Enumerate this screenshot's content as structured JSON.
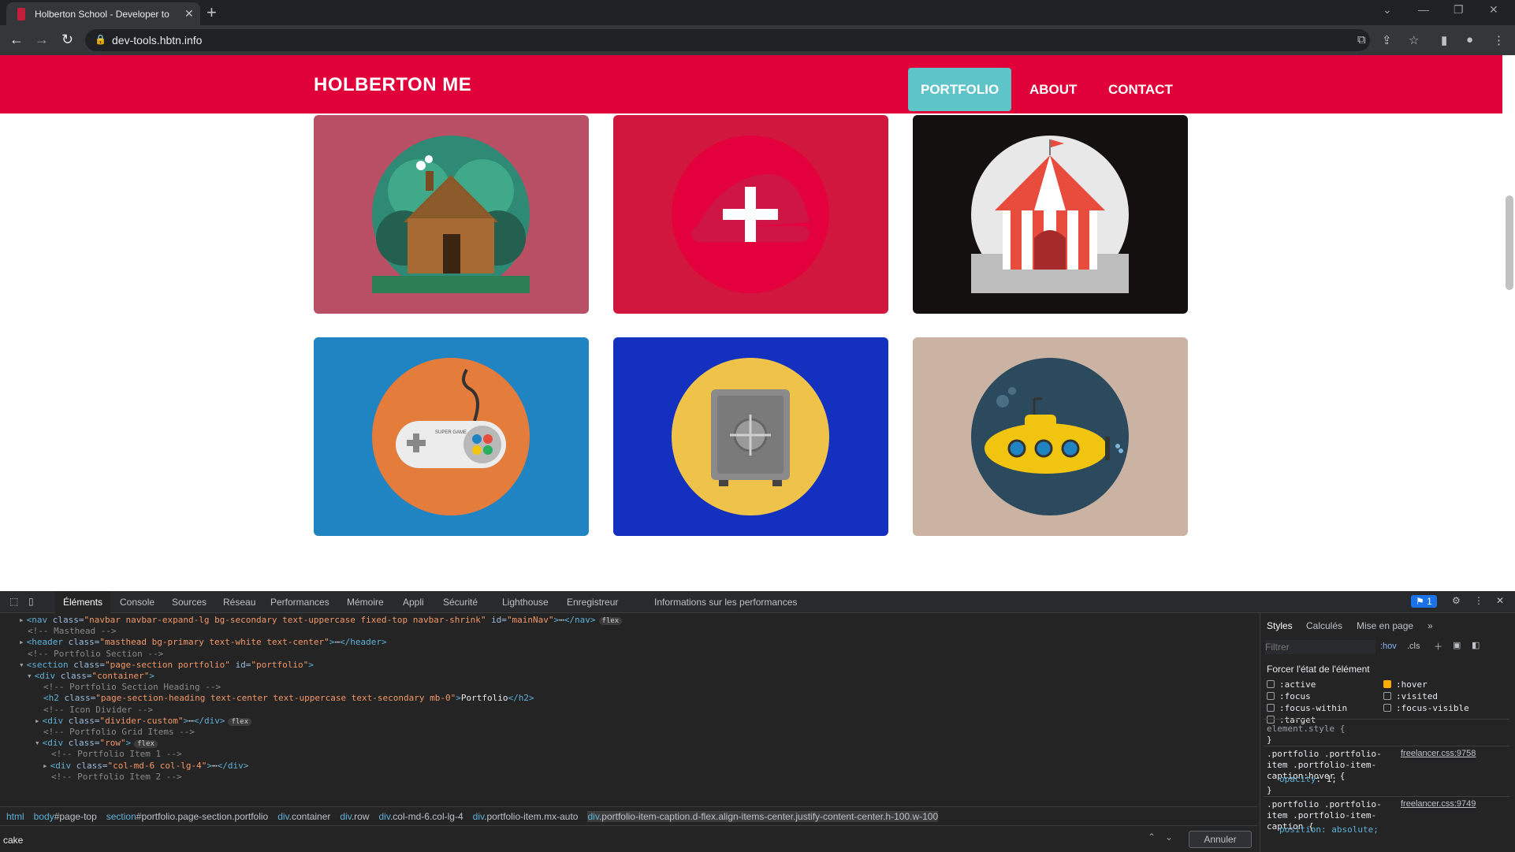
{
  "browser": {
    "tab_title": "Holberton School - Developer to",
    "url": "dev-tools.hbtn.info"
  },
  "site": {
    "brand": "HOLBERTON ME",
    "nav": [
      "PORTFOLIO",
      "ABOUT",
      "CONTACT"
    ],
    "active_nav": "PORTFOLIO",
    "portfolio": [
      {
        "image": "log-cabin",
        "bg": "#b94f65"
      },
      {
        "image": "cake",
        "bg": "#d2173e"
      },
      {
        "image": "circus-tent",
        "bg": "#141010"
      },
      {
        "image": "game-controller",
        "bg": "#1f84c1"
      },
      {
        "image": "safe",
        "bg": "#1430be"
      },
      {
        "image": "submarine",
        "bg": "#cbb3a3"
      }
    ],
    "controller_text": "SUPER GAME"
  },
  "devtools": {
    "tabs": [
      "Éléments",
      "Console",
      "Sources",
      "Réseau",
      "Performances",
      "Mémoire",
      "Appli",
      "Sécurité",
      "Lighthouse",
      "Enregistreur",
      "Informations sur les performances"
    ],
    "issues_count": "1",
    "dom_lines": [
      {
        "indent": 0,
        "arrow": "▸",
        "html": "<span class=\"tag\">&lt;nav</span> <span class=\"att\">class=</span><span class=\"val\">\"navbar navbar-expand-lg bg-secondary text-uppercase fixed-top navbar-shrink\"</span> <span class=\"att\">id=</span><span class=\"val\">\"mainNav\"</span><span class=\"tag\">&gt;</span>⋯<span class=\"tag\">&lt;/nav&gt;</span>",
        "badge": "flex"
      },
      {
        "indent": 0,
        "arrow": "",
        "html": "<span class=\"cm\">&lt;!-- Masthead --&gt;</span>"
      },
      {
        "indent": 0,
        "arrow": "▸",
        "html": "<span class=\"tag\">&lt;header</span> <span class=\"att\">class=</span><span class=\"val\">\"masthead bg-primary text-white text-center\"</span><span class=\"tag\">&gt;</span>⋯<span class=\"tag\">&lt;/header&gt;</span>"
      },
      {
        "indent": 0,
        "arrow": "",
        "html": "<span class=\"cm\">&lt;!-- Portfolio Section --&gt;</span>"
      },
      {
        "indent": 0,
        "arrow": "▾",
        "html": "<span class=\"tag\">&lt;section</span> <span class=\"att\">class=</span><span class=\"val\">\"page-section portfolio\"</span> <span class=\"att\">id=</span><span class=\"val\">\"portfolio\"</span><span class=\"tag\">&gt;</span>"
      },
      {
        "indent": 1,
        "arrow": "▾",
        "html": "<span class=\"tag\">&lt;div</span> <span class=\"att\">class=</span><span class=\"val\">\"container\"</span><span class=\"tag\">&gt;</span>"
      },
      {
        "indent": 2,
        "arrow": "",
        "html": "<span class=\"cm\">&lt;!-- Portfolio Section Heading --&gt;</span>"
      },
      {
        "indent": 2,
        "arrow": "",
        "html": "<span class=\"tag\">&lt;h2</span> <span class=\"att\">class=</span><span class=\"val\">\"page-section-heading text-center text-uppercase text-secondary mb-0\"</span><span class=\"tag\">&gt;</span><span class=\"txt\">Portfolio</span><span class=\"tag\">&lt;/h2&gt;</span>"
      },
      {
        "indent": 2,
        "arrow": "",
        "html": "<span class=\"cm\">&lt;!-- Icon Divider --&gt;</span>"
      },
      {
        "indent": 2,
        "arrow": "▸",
        "html": "<span class=\"tag\">&lt;div</span> <span class=\"att\">class=</span><span class=\"val\">\"divider-custom\"</span><span class=\"tag\">&gt;</span>⋯<span class=\"tag\">&lt;/div&gt;</span>",
        "badge": "flex"
      },
      {
        "indent": 2,
        "arrow": "",
        "html": "<span class=\"cm\">&lt;!-- Portfolio Grid Items --&gt;</span>"
      },
      {
        "indent": 2,
        "arrow": "▾",
        "html": "<span class=\"tag\">&lt;div</span> <span class=\"att\">class=</span><span class=\"val\">\"row\"</span><span class=\"tag\">&gt;</span>",
        "badge": "flex"
      },
      {
        "indent": 3,
        "arrow": "",
        "html": "<span class=\"cm\">&lt;!-- Portfolio Item 1 --&gt;</span>"
      },
      {
        "indent": 3,
        "arrow": "▸",
        "html": "<span class=\"tag\">&lt;div</span> <span class=\"att\">class=</span><span class=\"val\">\"col-md-6 col-lg-4\"</span><span class=\"tag\">&gt;</span>⋯<span class=\"tag\">&lt;/div&gt;</span>"
      },
      {
        "indent": 3,
        "arrow": "",
        "html": "<span class=\"cm\">&lt;!-- Portfolio Item 2 --&gt;</span>"
      }
    ],
    "breadcrumbs": [
      {
        "a": "html",
        "b": ""
      },
      {
        "a": "body",
        "b": "#page-top"
      },
      {
        "a": "section",
        "b": "#portfolio.page-section.portfolio"
      },
      {
        "a": "div",
        "b": ".container"
      },
      {
        "a": "div",
        "b": ".row"
      },
      {
        "a": "div",
        "b": ".col-md-6.col-lg-4"
      },
      {
        "a": "div",
        "b": ".portfolio-item.mx-auto"
      },
      {
        "a": "div",
        "b": ".portfolio-item-caption.d-flex.align-items-center.justify-content-center.h-100.w-100"
      }
    ],
    "search_value": "cake",
    "cancel_label": "Annuler",
    "styles": {
      "tabs": [
        "Styles",
        "Calculés",
        "Mise en page"
      ],
      "filter_placeholder": "Filtrer",
      "hov": ":hov",
      "cls": ".cls",
      "force_state_title": "Forcer l'état de l'élément",
      "states": [
        {
          "label": ":active",
          "checked": false
        },
        {
          "label": ":hover",
          "checked": true
        },
        {
          "label": ":focus",
          "checked": false
        },
        {
          "label": ":visited",
          "checked": false
        },
        {
          "label": ":focus-within",
          "checked": false
        },
        {
          "label": ":focus-visible",
          "checked": false
        },
        {
          "label": ":target",
          "checked": false
        }
      ],
      "element_style": "element.style {",
      "close_brace": "}",
      "rule1_selector": ".portfolio .portfolio-item .portfolio-item-caption:hover {",
      "rule1_source": "freelancer.css:9758",
      "rule1_decl_prop": "opacity",
      "rule1_decl_val": "1;",
      "rule2_selector": ".portfolio .portfolio-item .portfolio-item-caption {",
      "rule2_source": "freelancer.css:9749",
      "rule2_decl": "position: absolute;"
    }
  }
}
